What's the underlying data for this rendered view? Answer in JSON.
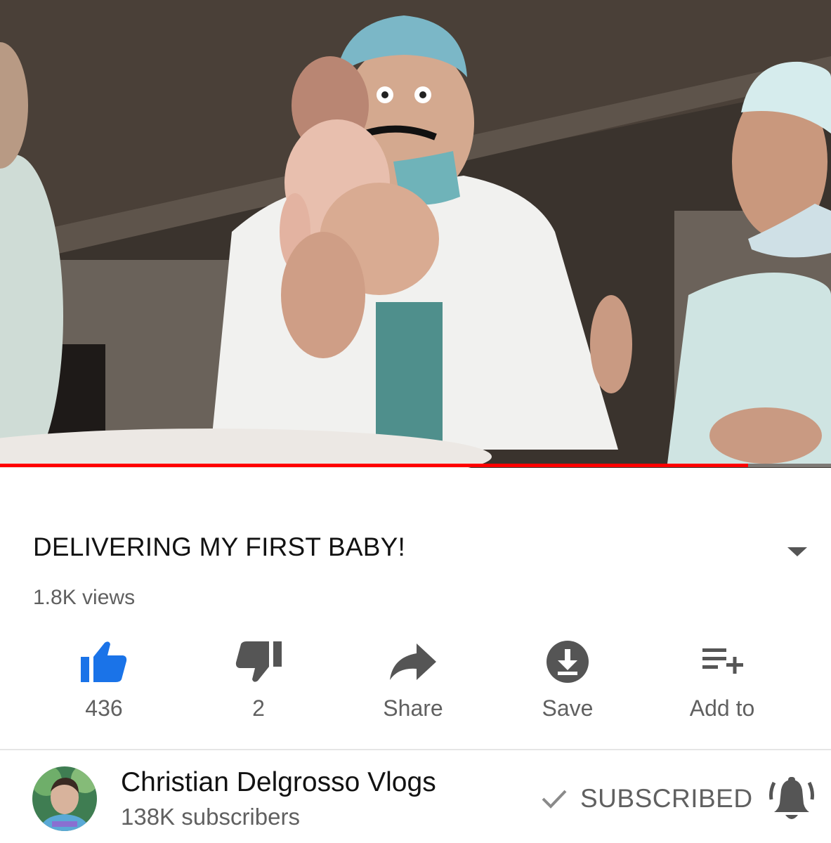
{
  "video": {
    "title": "DELIVERING MY FIRST BABY!",
    "views": "1.8K views",
    "progress_fraction": 0.9
  },
  "actions": [
    {
      "id": "like",
      "label": "436",
      "icon": "thumbs-up-icon",
      "color": "#1a73e8"
    },
    {
      "id": "dislike",
      "label": "2",
      "icon": "thumbs-down-icon",
      "color": "#606060"
    },
    {
      "id": "share",
      "label": "Share",
      "icon": "share-arrow-icon",
      "color": "#606060"
    },
    {
      "id": "save",
      "label": "Save",
      "icon": "download-icon",
      "color": "#606060"
    },
    {
      "id": "add_to",
      "label": "Add to",
      "icon": "playlist-add-icon",
      "color": "#606060"
    }
  ],
  "channel": {
    "name": "Christian Delgrosso Vlogs",
    "subscribers": "138K subscribers",
    "subscribe_state": "SUBSCRIBED"
  },
  "colors": {
    "progress": "#ff0000",
    "like_active": "#1a73e8",
    "secondary_text": "#606060",
    "primary_text": "#121212"
  }
}
